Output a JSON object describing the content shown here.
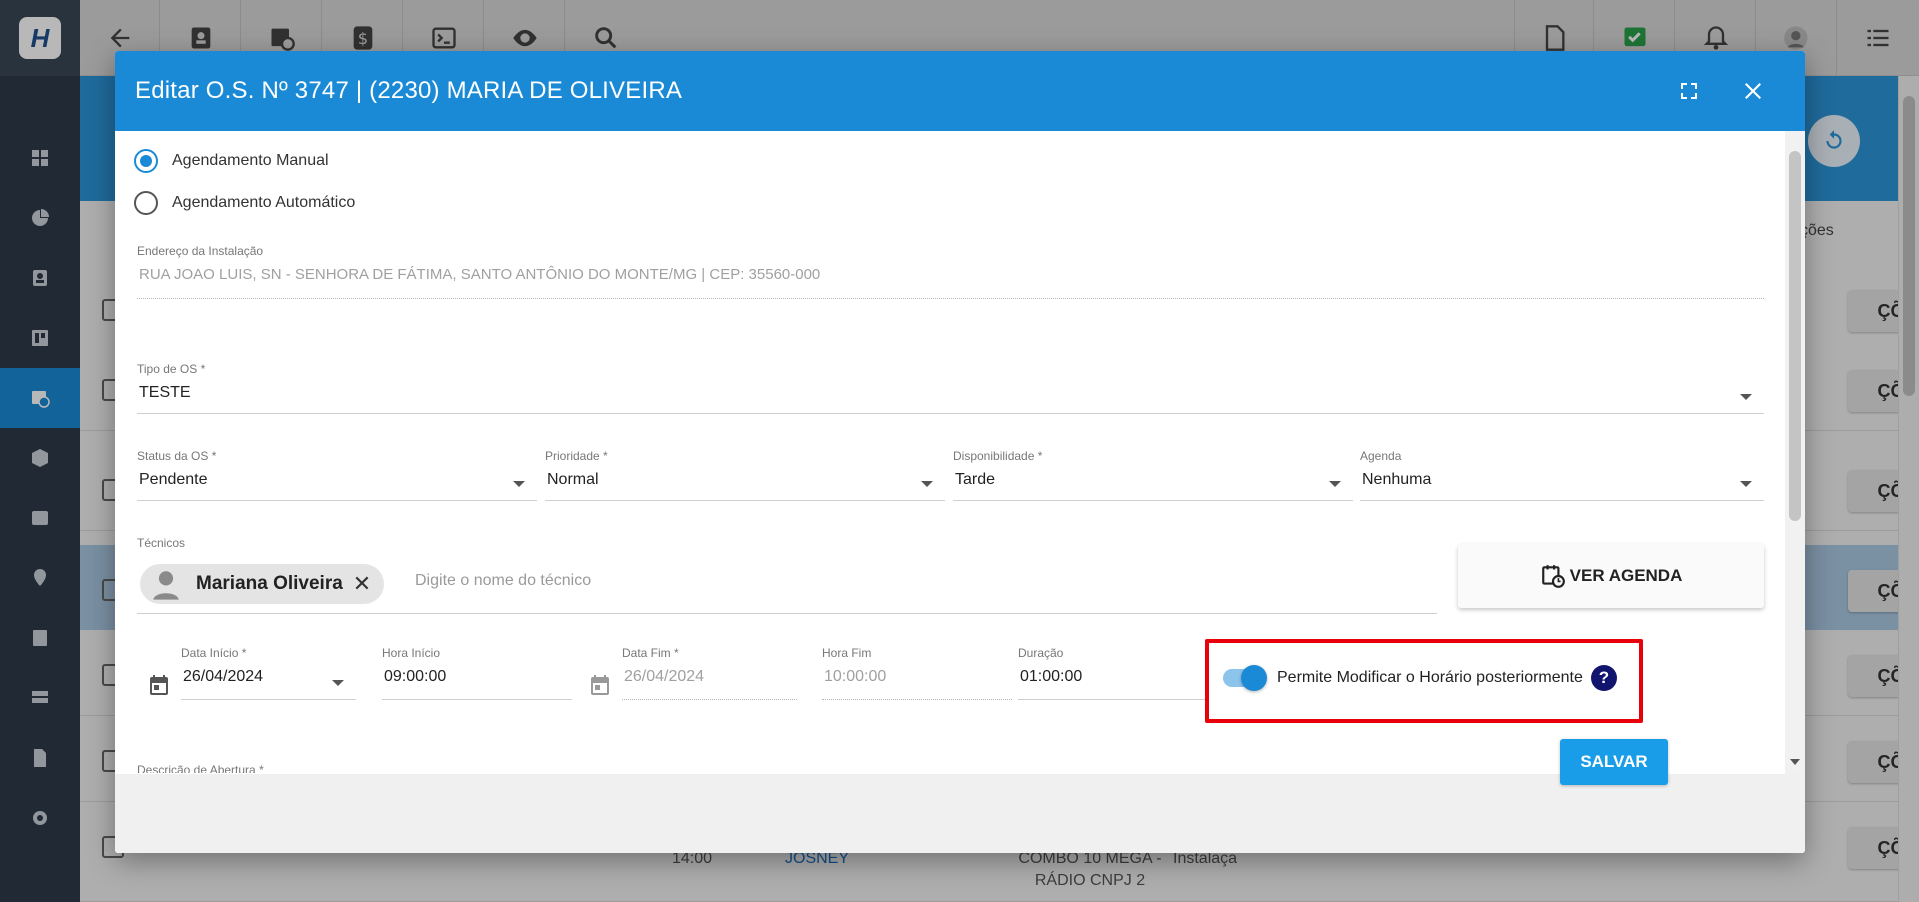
{
  "app": {
    "logo_letter": "H"
  },
  "background": {
    "column_header_fragment": "ções",
    "row_action_fragment": "ÇÕES",
    "row_bottom": {
      "time": "14:00",
      "tech": "JOSNEY",
      "plan_line1": "COMBO 10 MEGA -",
      "plan_line2": "RÁDIO CNPJ 2",
      "type": "Instalaça"
    }
  },
  "modal": {
    "title": "Editar O.S. Nº 3747 | (2230) MARIA DE OLIVEIRA",
    "scheduling": {
      "manual_label": "Agendamento Manual",
      "auto_label": "Agendamento Automático",
      "selected": "manual"
    },
    "address": {
      "label": "Endereço da Instalação",
      "value": "RUA JOAO LUIS, SN - SENHORA DE FÁTIMA, SANTO ANTÔNIO DO MONTE/MG | CEP: 35560-000"
    },
    "tipo_os": {
      "label": "Tipo de OS *",
      "value": "TESTE"
    },
    "status_os": {
      "label": "Status da OS *",
      "value": "Pendente"
    },
    "prioridade": {
      "label": "Prioridade *",
      "value": "Normal"
    },
    "disponibilidade": {
      "label": "Disponibilidade *",
      "value": "Tarde"
    },
    "agenda": {
      "label": "Agenda",
      "value": "Nenhuma"
    },
    "tecnicos": {
      "label": "Técnicos",
      "chip_name": "Mariana Oliveira",
      "placeholder": "Digite o nome do técnico"
    },
    "ver_agenda_label": "VER AGENDA",
    "data_inicio": {
      "label": "Data Início *",
      "value": "26/04/2024"
    },
    "hora_inicio": {
      "label": "Hora Início",
      "value": "09:00:00"
    },
    "data_fim": {
      "label": "Data Fim *",
      "value": "26/04/2024"
    },
    "hora_fim": {
      "label": "Hora Fim",
      "value": "10:00:00"
    },
    "duracao": {
      "label": "Duração",
      "value": "01:00:00"
    },
    "permite_modificar": {
      "label": "Permite Modificar o Horário posteriormente",
      "enabled": true,
      "help": "?"
    },
    "descricao_label": "Descrição de Abertura *",
    "save_label": "SALVAR"
  },
  "colors": {
    "primary": "#1a8ad6",
    "highlight_box": "#e8000b",
    "sidebar": "#2f3b48",
    "help_icon": "#12156e"
  }
}
